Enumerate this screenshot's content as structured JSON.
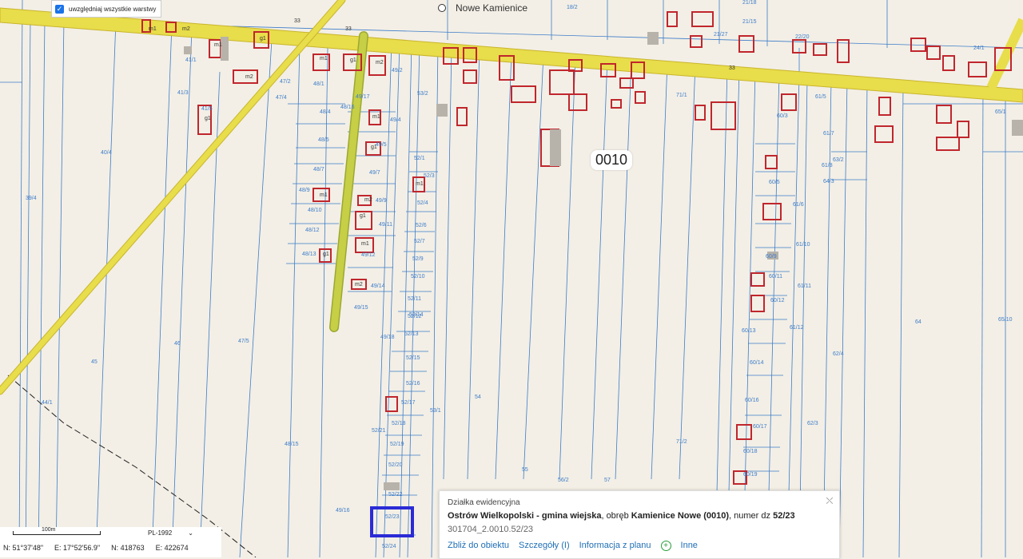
{
  "layers_toggle": {
    "label": "uwzględniaj wszystkie warstwy",
    "checked": true
  },
  "town_label": "Nowe Kamienice",
  "district_label": "0010",
  "road_labels": [
    "33",
    "33",
    "33"
  ],
  "parcel_labels": [
    "39/4",
    "40/4",
    "41/3",
    "41/5",
    "41/1",
    "47/2",
    "47/4",
    "48/1",
    "48/4",
    "48/5",
    "48/7",
    "48/9",
    "48/10",
    "48/12",
    "48/13",
    "48/15",
    "48/16",
    "49/2",
    "49/4",
    "49/5",
    "49/7",
    "49/9",
    "49/11",
    "49/12",
    "49/14",
    "49/15",
    "49/16",
    "49/17",
    "49/18",
    "52/1",
    "52/3",
    "52/4",
    "52/6",
    "52/7",
    "52/9",
    "52/10",
    "52/11",
    "52/12",
    "52/13",
    "52/14",
    "52/15",
    "52/16",
    "52/17",
    "52/18",
    "52/19",
    "52/20",
    "52/21",
    "52/22",
    "52/23",
    "52/24",
    "53/2",
    "53/1",
    "54",
    "55",
    "56/2",
    "57",
    "45",
    "46",
    "47/5",
    "44/1",
    "71/1",
    "71/2",
    "60/3",
    "60/5",
    "60/9",
    "60/11",
    "60/12",
    "60/13",
    "60/14",
    "60/16",
    "60/17",
    "60/18",
    "60/19",
    "61/5",
    "61/6",
    "61/7",
    "61/8",
    "61/10",
    "61/11",
    "61/12",
    "62/3",
    "62/4",
    "63/2",
    "64",
    "64/3",
    "65/1",
    "65/10",
    "18/2",
    "21/18",
    "21/15",
    "21/27",
    "22/20",
    "24/1"
  ],
  "building_labels": [
    "m1",
    "m2",
    "g1",
    "m1",
    "m2",
    "g1",
    "m1",
    "g1",
    "m2",
    "m1",
    "g1",
    "m1",
    "m2",
    "g1",
    "m1",
    "g1",
    "m2",
    "m1"
  ],
  "popup": {
    "title": "Działka ewidencyjna",
    "desc_bold1": "Ostrów Wielkopolski - gmina wiejska",
    "desc_mid1": ", obręb ",
    "desc_bold2": "Kamienice Nowe (0010)",
    "desc_mid2": ", numer dz ",
    "desc_bold3": "52/23",
    "parcel_id": "301704_2.0010.52/23",
    "actions": [
      "Zbliż do obiektu",
      "Szczegóły (I)",
      "Informacja z planu",
      "Inne"
    ]
  },
  "scale": {
    "label": "100m",
    "crs": "PL-1992"
  },
  "coords": {
    "lat": "N: 51°37'48\"",
    "lon": "E: 17°52'56.9\"",
    "n": "N: 418763",
    "e": "E: 422674"
  },
  "colors": {
    "background": "#f3efe6",
    "road": "#e8dd4a",
    "parcel_line": "#3d7cc9",
    "building": "#c0262d",
    "selection": "#2b2bd6"
  }
}
